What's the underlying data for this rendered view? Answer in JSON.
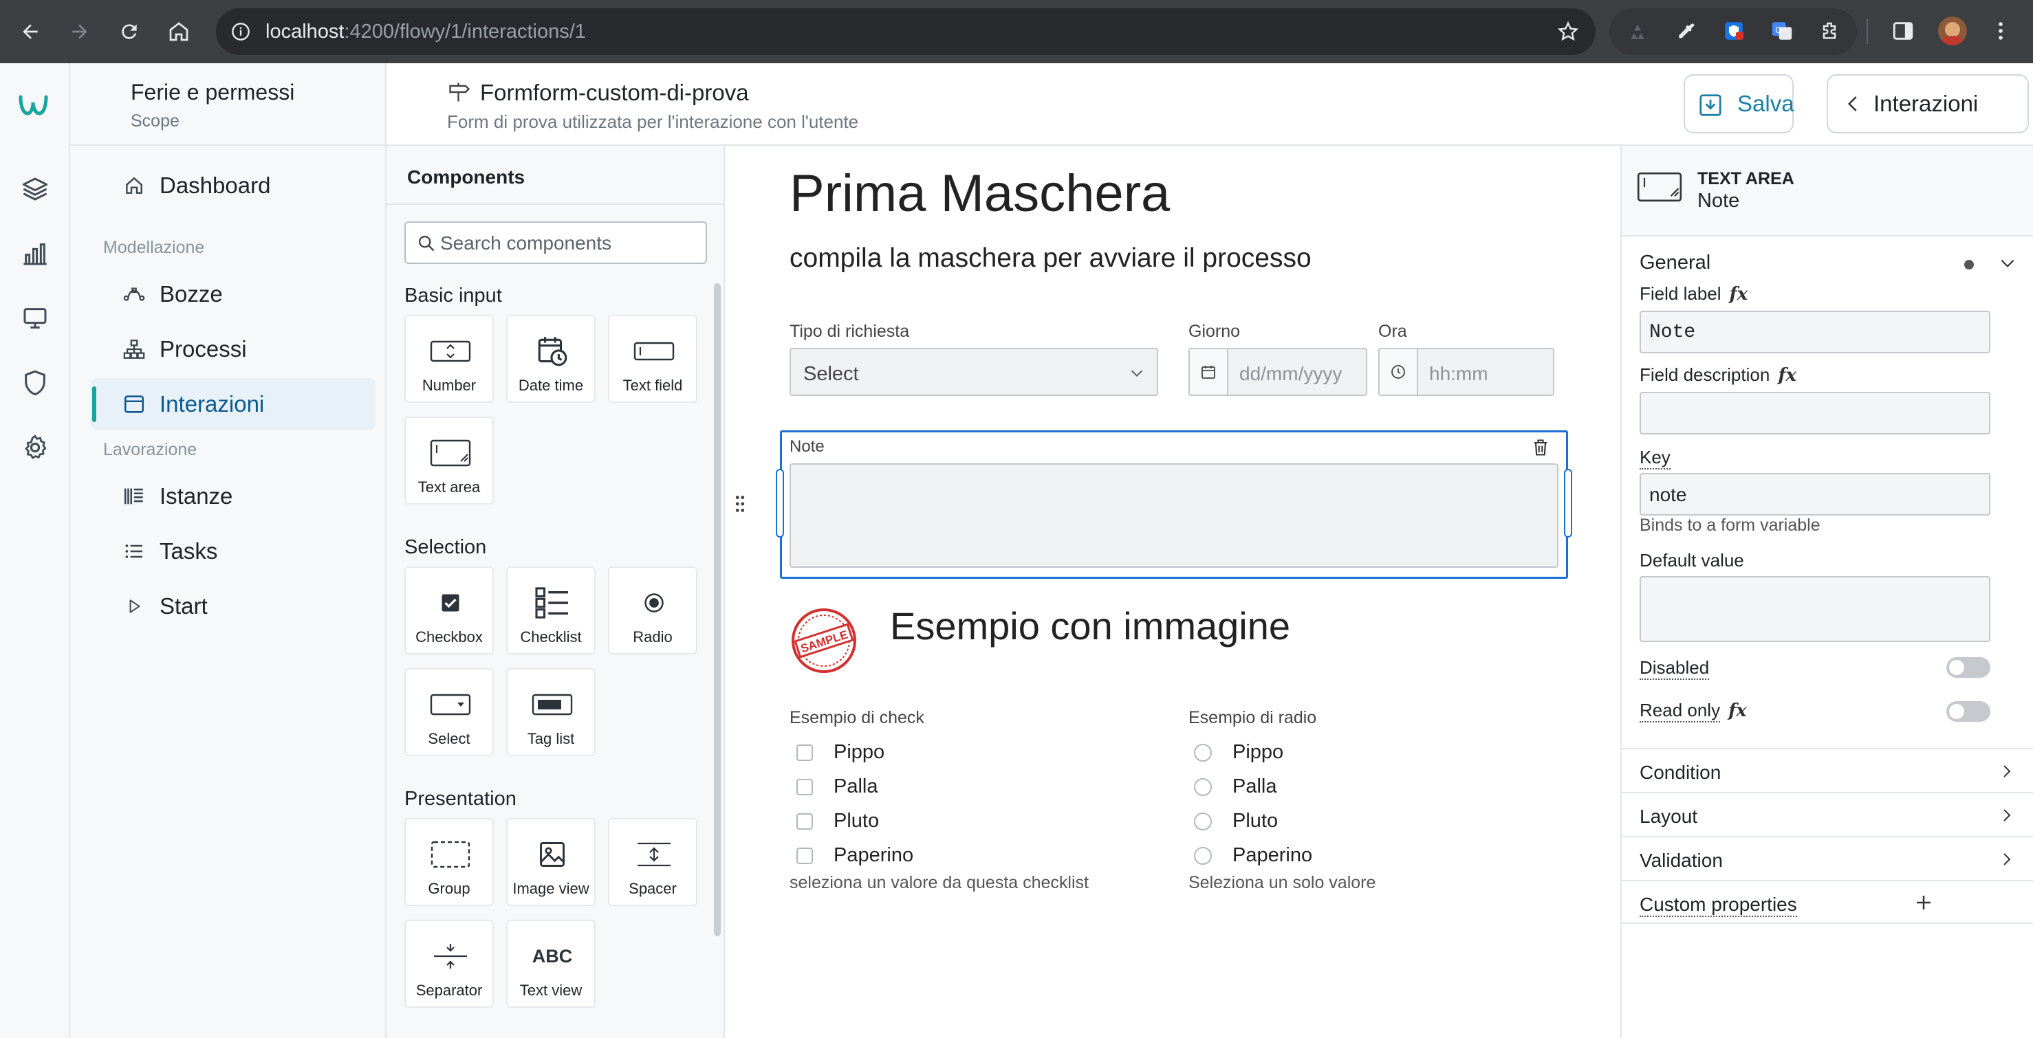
{
  "browser": {
    "url_host": "localhost",
    "url_path": ":4200/flowy/1/interactions/1"
  },
  "nav": {
    "scope_title": "Ferie e permessi",
    "scope_subtitle": "Scope",
    "dashboard": "Dashboard",
    "section_modellazione": "Modellazione",
    "bozze": "Bozze",
    "processi": "Processi",
    "interazioni": "Interazioni",
    "section_lavorazione": "Lavorazione",
    "istanze": "Istanze",
    "tasks": "Tasks",
    "start": "Start"
  },
  "header": {
    "title": "Formform-custom-di-prova",
    "subtitle": "Form di prova utilizzata per l'interazione con l'utente",
    "save_label": "Salva",
    "back_label": "Interazioni"
  },
  "palette": {
    "title": "Components",
    "search_placeholder": "Search components",
    "sections": {
      "basic": "Basic input",
      "selection": "Selection",
      "presentation": "Presentation"
    },
    "items": {
      "number": "Number",
      "datetime": "Date time",
      "textfield": "Text field",
      "textarea": "Text area",
      "checkbox": "Checkbox",
      "checklist": "Checklist",
      "radio": "Radio",
      "select": "Select",
      "taglist": "Tag list",
      "group": "Group",
      "imageview": "Image view",
      "spacer": "Spacer",
      "separator": "Separator",
      "textview": "Text view",
      "textview_glyph": "ABC"
    }
  },
  "canvas": {
    "title": "Prima Maschera",
    "subtitle": "compila la maschera per avviare il processo",
    "tipo_label": "Tipo di richiesta",
    "tipo_value": "Select",
    "giorno_label": "Giorno",
    "giorno_placeholder": "dd/mm/yyyy",
    "ora_label": "Ora",
    "ora_placeholder": "hh:mm",
    "note_label": "Note",
    "sample_stamp": "SAMPLE",
    "image_title": "Esempio con immagine",
    "check_label": "Esempio di check",
    "check_options": [
      "Pippo",
      "Palla",
      "Pluto",
      "Paperino"
    ],
    "check_help": "seleziona un valore da questa checklist",
    "radio_label": "Esempio di radio",
    "radio_options": [
      "Pippo",
      "Palla",
      "Pluto",
      "Paperino"
    ],
    "radio_help": "Seleziona un solo valore"
  },
  "props": {
    "type": "TEXT AREA",
    "name": "Note",
    "general": "General",
    "field_label": "Field label",
    "field_label_value": "Note",
    "field_description": "Field description",
    "field_description_value": "",
    "key": "Key",
    "key_value": "note",
    "key_help": "Binds to a form variable",
    "default_value": "Default value",
    "disabled": "Disabled",
    "disabled_on": false,
    "read_only": "Read only",
    "read_only_on": false,
    "fx": "fx",
    "condition": "Condition",
    "layout": "Layout",
    "validation": "Validation",
    "custom_properties": "Custom properties"
  },
  "colors": {
    "accent": "#1aa3a0",
    "link": "#0b5a8f",
    "save": "#1b7fa6",
    "selection": "#1a6fd1",
    "stamp": "#d32f2f"
  }
}
